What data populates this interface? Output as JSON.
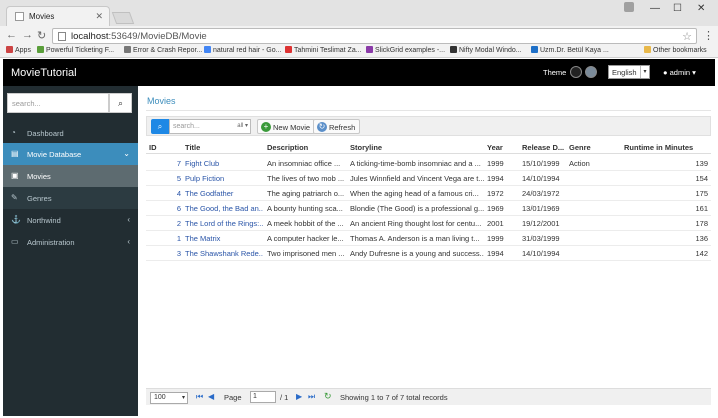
{
  "browser": {
    "tab_title": "Movies",
    "url_host": "localhost",
    "url_path": ":53649/MovieDB/Movie",
    "bookmarks": [
      {
        "label": "Apps",
        "color": "#c44"
      },
      {
        "label": "Powerful Ticketing F...",
        "color": "#5a9e3a"
      },
      {
        "label": "Error & Crash Repor...",
        "color": "#777"
      },
      {
        "label": "natural red hair - Go...",
        "color": "#4285f4"
      },
      {
        "label": "Tahmini Teslimat Za...",
        "color": "#d33"
      },
      {
        "label": "SlickGrid examples -...",
        "color": "#8a3aa8"
      },
      {
        "label": "Nifty Modal Windo...",
        "color": "#333"
      },
      {
        "label": "Uzm.Dr. Betül Kaya ...",
        "color": "#1e70c8"
      }
    ],
    "other_bookmarks": "Other bookmarks"
  },
  "header": {
    "brand": "MovieTutorial",
    "theme_label": "Theme",
    "language": "English",
    "user": "admin"
  },
  "sidebar": {
    "search_placeholder": "search...",
    "items": [
      {
        "label": "Dashboard"
      },
      {
        "label": "Movie Database"
      },
      {
        "label": "Movies"
      },
      {
        "label": "Genres"
      },
      {
        "label": "Northwind"
      },
      {
        "label": "Administration"
      }
    ]
  },
  "page": {
    "title": "Movies",
    "search_placeholder": "search...",
    "search_flag": "all",
    "new_button": "New Movie",
    "refresh_button": "Refresh"
  },
  "grid": {
    "columns": [
      "ID",
      "Title",
      "Description",
      "Storyline",
      "Year",
      "Release D...",
      "Genre",
      "Runtime in Minutes"
    ],
    "rows": [
      {
        "id": "7",
        "title": "Fight Club",
        "description": "An insomniac office ...",
        "storyline": "A ticking-time-bomb insomniac and a ...",
        "year": "1999",
        "release": "15/10/1999",
        "genre": "Action",
        "runtime": "139"
      },
      {
        "id": "5",
        "title": "Pulp Fiction",
        "description": "The lives of two mob ...",
        "storyline": "Jules Winnfield and Vincent Vega are t...",
        "year": "1994",
        "release": "14/10/1994",
        "genre": "",
        "runtime": "154"
      },
      {
        "id": "4",
        "title": "The Godfather",
        "description": "The aging patriarch o...",
        "storyline": "When the aging head of a famous cri...",
        "year": "1972",
        "release": "24/03/1972",
        "genre": "",
        "runtime": "175"
      },
      {
        "id": "6",
        "title": "The Good, the Bad an...",
        "description": "A bounty hunting sca...",
        "storyline": "Blondie (The Good) is a professional g...",
        "year": "1969",
        "release": "13/01/1969",
        "genre": "",
        "runtime": "161"
      },
      {
        "id": "2",
        "title": "The Lord of the Rings:...",
        "description": "A meek hobbit of the ...",
        "storyline": "An ancient Ring thought lost for centu...",
        "year": "2001",
        "release": "19/12/2001",
        "genre": "",
        "runtime": "178"
      },
      {
        "id": "1",
        "title": "The Matrix",
        "description": "A computer hacker le...",
        "storyline": "Thomas A. Anderson is a man living t...",
        "year": "1999",
        "release": "31/03/1999",
        "genre": "",
        "runtime": "136"
      },
      {
        "id": "3",
        "title": "The Shawshank Rede...",
        "description": "Two imprisoned men ...",
        "storyline": "Andy Dufresne is a young and success...",
        "year": "1994",
        "release": "14/10/1994",
        "genre": "",
        "runtime": "142"
      }
    ]
  },
  "pager": {
    "page_size": "100",
    "page_label": "Page",
    "page_value": "1",
    "page_total": "/ 1",
    "status": "Showing 1 to 7 of 7 total records"
  },
  "colors": {
    "accent": "#3c8dbc",
    "sidebar_bg": "#222d32",
    "header_bg": "#000000",
    "link": "#2a55a8"
  }
}
